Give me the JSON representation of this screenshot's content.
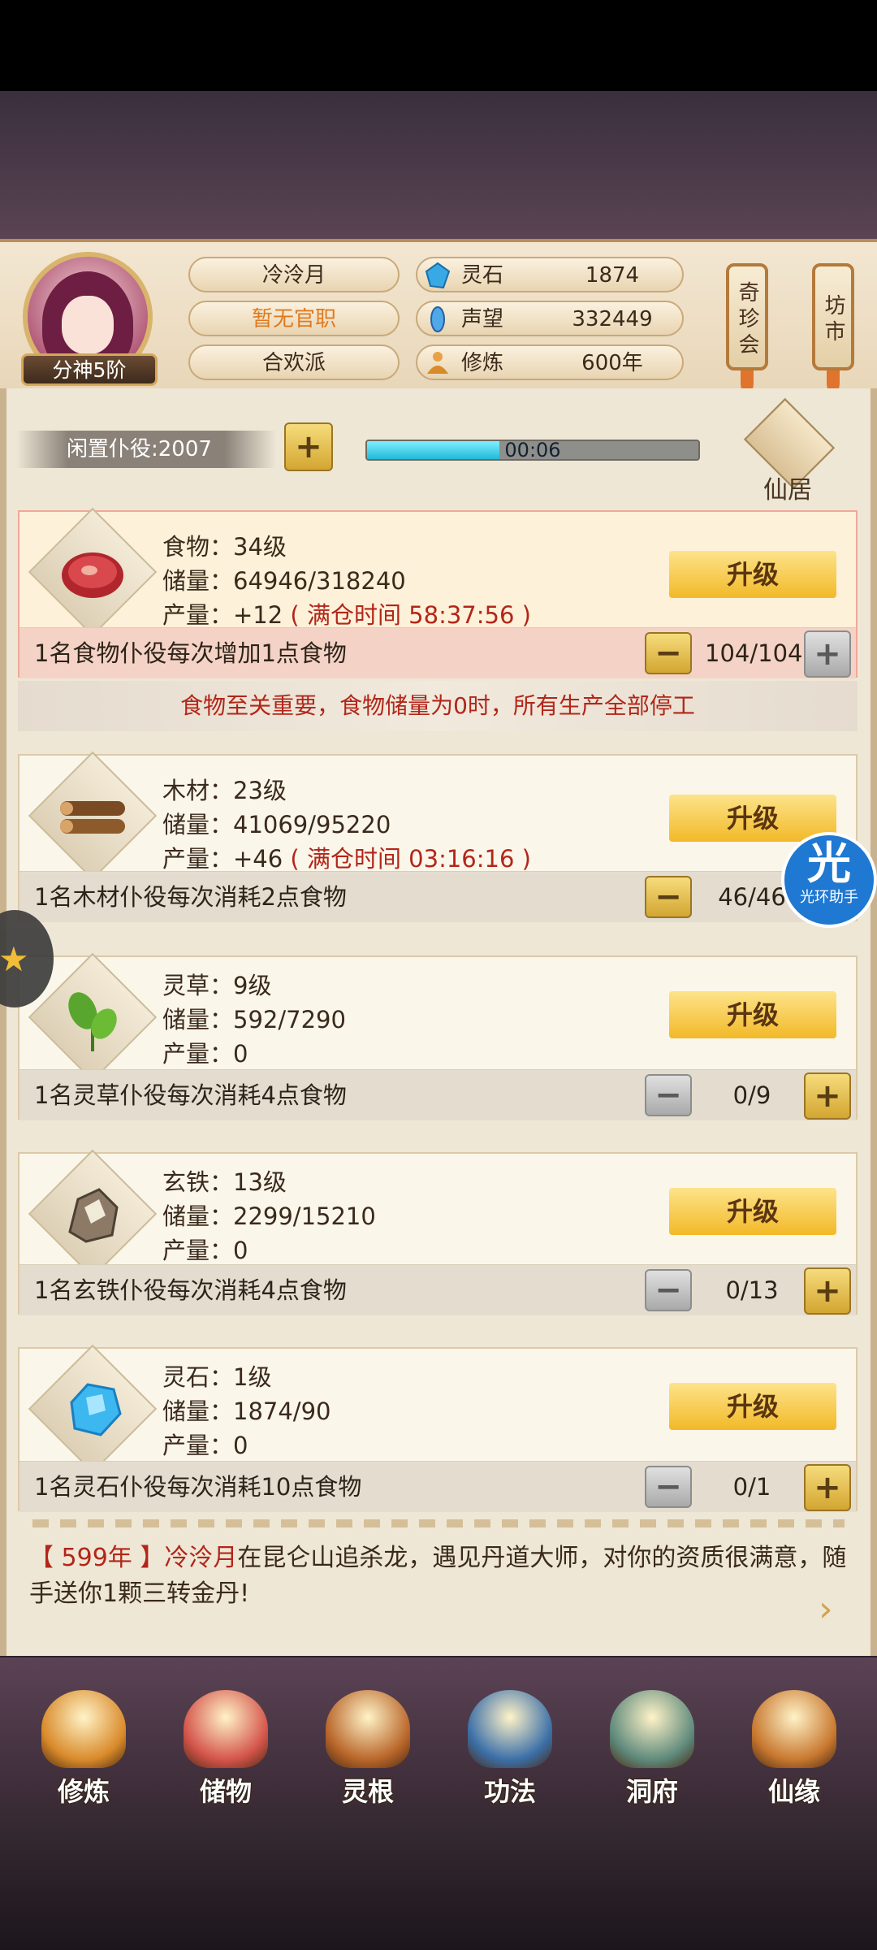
{
  "header": {
    "player_name": "冷泠月",
    "official_title": "暂无官职",
    "sect": "合欢派",
    "rank": "分神5阶",
    "resources": [
      {
        "icon": "spirit-stone-icon",
        "label": "灵石",
        "value": "1874"
      },
      {
        "icon": "reputation-icon",
        "label": "声望",
        "value": "332449"
      },
      {
        "icon": "cultivation-icon",
        "label": "修炼",
        "value": "600年"
      }
    ],
    "side_buttons": [
      "奇珍会",
      "坊市"
    ]
  },
  "idle": {
    "label": "闲置仆役:2007",
    "timer": "00:06",
    "progress_fraction": 0.4,
    "xianju_label": "仙居"
  },
  "warning": "食物至关重要，食物储量为0时，所有生产全部停工",
  "resources": [
    {
      "name_level": "食物：34级",
      "storage": "储量：64946/318240",
      "output": "产量：+12",
      "full_time": "( 满仓时间 58:37:56 )",
      "upgrade": "升级",
      "desc": "1名食物仆役每次增加1点食物",
      "count": "104/104"
    },
    {
      "name_level": "木材：23级",
      "storage": "储量：41069/95220",
      "output": "产量：+46",
      "full_time": "( 满仓时间 03:16:16 )",
      "upgrade": "升级",
      "desc": "1名木材仆役每次消耗2点食物",
      "count": "46/46"
    },
    {
      "name_level": "灵草：9级",
      "storage": "储量：592/7290",
      "output": "产量：0",
      "full_time": "",
      "upgrade": "升级",
      "desc": "1名灵草仆役每次消耗4点食物",
      "count": "0/9"
    },
    {
      "name_level": "玄铁：13级",
      "storage": "储量：2299/15210",
      "output": "产量：0",
      "full_time": "",
      "upgrade": "升级",
      "desc": "1名玄铁仆役每次消耗4点食物",
      "count": "0/13"
    },
    {
      "name_level": "灵石：1级",
      "storage": "储量：1874/90",
      "output": "产量：0",
      "full_time": "",
      "upgrade": "升级",
      "desc": "1名灵石仆役每次消耗10点食物",
      "count": "0/1"
    }
  ],
  "event": {
    "year": "【 599年 】",
    "name": "冷泠月",
    "text": "在昆仑山追杀龙，遇见丹道大师，对你的资质很满意，随手送你1颗三转金丹!"
  },
  "helper_badge": {
    "glyph": "光",
    "label": "光环助手"
  },
  "nav": [
    {
      "label": "修炼",
      "icon": "cultivate-icon",
      "color": "#d98a2a"
    },
    {
      "label": "储物",
      "icon": "storage-bag-icon",
      "color": "#d4544a"
    },
    {
      "label": "灵根",
      "icon": "spirit-root-icon",
      "color": "#b9662a"
    },
    {
      "label": "功法",
      "icon": "technique-book-icon",
      "color": "#3b6fa8"
    },
    {
      "label": "洞府",
      "icon": "cave-gate-icon",
      "color": "#5f8a7c"
    },
    {
      "label": "仙缘",
      "icon": "gourd-icon",
      "color": "#c8782f"
    }
  ]
}
